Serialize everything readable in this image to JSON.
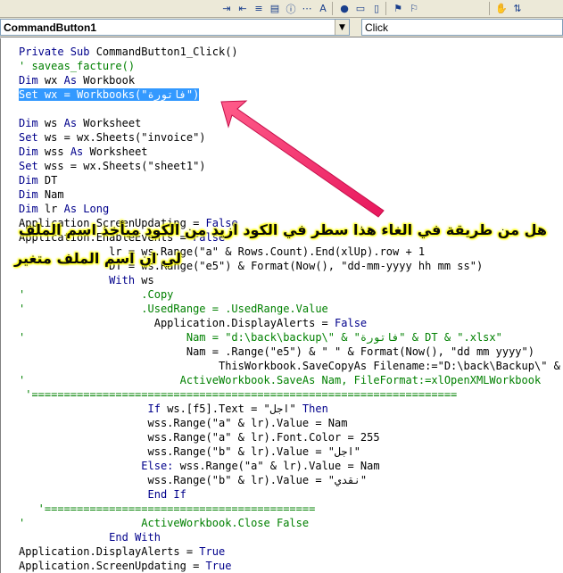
{
  "toolbar": {
    "icons": [
      "indent-icon",
      "outdent-icon",
      "list-properties-icon",
      "list-constants-icon",
      "quick-info-icon",
      "parameter-info-icon",
      "complete-word-icon",
      "toggle-breakpoint-icon",
      "comment-block-icon",
      "uncomment-block-icon",
      "toggle-bookmark-icon",
      "next-bookmark-icon",
      "previous-bookmark-icon",
      "clear-bookmarks-icon"
    ]
  },
  "combobar": {
    "object_value": "CommandButton1",
    "procedure_value": "Click"
  },
  "code_lines": [
    [
      [
        "kw",
        "Private Sub "
      ],
      [
        "tx",
        "CommandButton1_Click()"
      ]
    ],
    [
      [
        "cm",
        "' saveas_facture()"
      ]
    ],
    [
      [
        "kw",
        "Dim "
      ],
      [
        "tx",
        "wx "
      ],
      [
        "kw",
        "As "
      ],
      [
        "tx",
        "Workbook"
      ]
    ],
    [
      [
        "sel",
        "Set wx = Workbooks(\"فاتورة\")"
      ]
    ],
    [],
    [
      [
        "kw",
        "Dim "
      ],
      [
        "tx",
        "ws "
      ],
      [
        "kw",
        "As "
      ],
      [
        "tx",
        "Worksheet"
      ]
    ],
    [
      [
        "kw",
        "Set "
      ],
      [
        "tx",
        "ws = wx.Sheets(\"invoice\")"
      ]
    ],
    [
      [
        "kw",
        "Dim "
      ],
      [
        "tx",
        "wss "
      ],
      [
        "kw",
        "As "
      ],
      [
        "tx",
        "Worksheet"
      ]
    ],
    [
      [
        "kw",
        "Set "
      ],
      [
        "tx",
        "wss = wx.Sheets(\"sheet1\")"
      ]
    ],
    [
      [
        "kw",
        "Dim "
      ],
      [
        "tx",
        "DT"
      ]
    ],
    [
      [
        "kw",
        "Dim "
      ],
      [
        "tx",
        "Nam"
      ]
    ],
    [
      [
        "kw",
        "Dim "
      ],
      [
        "tx",
        "lr "
      ],
      [
        "kw",
        "As Long"
      ]
    ],
    [
      [
        "tx",
        "Application.ScreenUpdating = "
      ],
      [
        "kw",
        "False"
      ]
    ],
    [
      [
        "tx",
        "Application.EnableEvents = "
      ],
      [
        "kw",
        "False"
      ]
    ],
    [
      [
        "tx",
        "              lr = ws.Range(\"a\" & Rows.Count).End(xlUp).row + 1"
      ]
    ],
    [
      [
        "tx",
        "              DT = ws.Range(\"e5\") & Format(Now(), \"dd-mm-yyyy hh mm ss\")"
      ]
    ],
    [
      [
        "tx",
        "              "
      ],
      [
        "kw",
        "With "
      ],
      [
        "tx",
        "ws"
      ]
    ],
    [
      [
        "cm",
        "'                  .Copy"
      ]
    ],
    [
      [
        "cm",
        "'                  .UsedRange = .UsedRange.Value"
      ]
    ],
    [
      [
        "tx",
        "                     Application.DisplayAlerts = "
      ],
      [
        "kw",
        "False"
      ]
    ],
    [
      [
        "cm",
        "'                         Nam = \"d:\\back\\backup\\\" & \"فاتورة\" & DT & \".xlsx\""
      ]
    ],
    [
      [
        "tx",
        "                          Nam = .Range(\"e5\") & \" \" & Format(Now(), \"dd mm yyyy\")"
      ]
    ],
    [
      [
        "tx",
        "                               ThisWorkbook.SaveCopyAs Filename:=\"D:\\back\\Backup\\\" & Nam"
      ]
    ],
    [
      [
        "cm",
        "'                        ActiveWorkbook.SaveAs Nam, FileFormat:=xlOpenXMLWorkbook"
      ]
    ],
    [
      [
        "cm",
        " '=================================================================="
      ]
    ],
    [
      [
        "tx",
        "                    "
      ],
      [
        "kw",
        "If "
      ],
      [
        "tx",
        "ws.[f5].Text = \"اجل\" "
      ],
      [
        "kw",
        "Then"
      ]
    ],
    [
      [
        "tx",
        "                    wss.Range(\"a\" & lr).Value = Nam"
      ]
    ],
    [
      [
        "tx",
        "                    wss.Range(\"a\" & lr).Font.Color = 255"
      ]
    ],
    [
      [
        "tx",
        "                    wss.Range(\"b\" & lr).Value = \"اجل\""
      ]
    ],
    [
      [
        "tx",
        "                   "
      ],
      [
        "kw",
        "Else: "
      ],
      [
        "tx",
        "wss.Range(\"a\" & lr).Value = Nam"
      ]
    ],
    [
      [
        "tx",
        "                    wss.Range(\"b\" & lr).Value = \"نقدي\""
      ]
    ],
    [
      [
        "tx",
        "                    "
      ],
      [
        "kw",
        "End If"
      ]
    ],
    [
      [
        "cm",
        "   '=========================================="
      ]
    ],
    [
      [
        "cm",
        "'                  ActiveWorkbook.Close False"
      ]
    ],
    [
      [
        "tx",
        "              "
      ],
      [
        "kw",
        "End With"
      ]
    ],
    [
      [
        "tx",
        "Application.DisplayAlerts = "
      ],
      [
        "kw",
        "True"
      ]
    ],
    [
      [
        "tx",
        "Application.ScreenUpdating = "
      ],
      [
        "kw",
        "True"
      ]
    ]
  ],
  "annotation": {
    "line1": "هل من طريقة في الغاء هذا سطر في الكود ازيد من الكود ميأخذ اسم الملف",
    "line2": "لي ان اسم الملف متغير",
    "arrow_color": "#ff2a6d",
    "highlight_color": "#ffff00"
  }
}
